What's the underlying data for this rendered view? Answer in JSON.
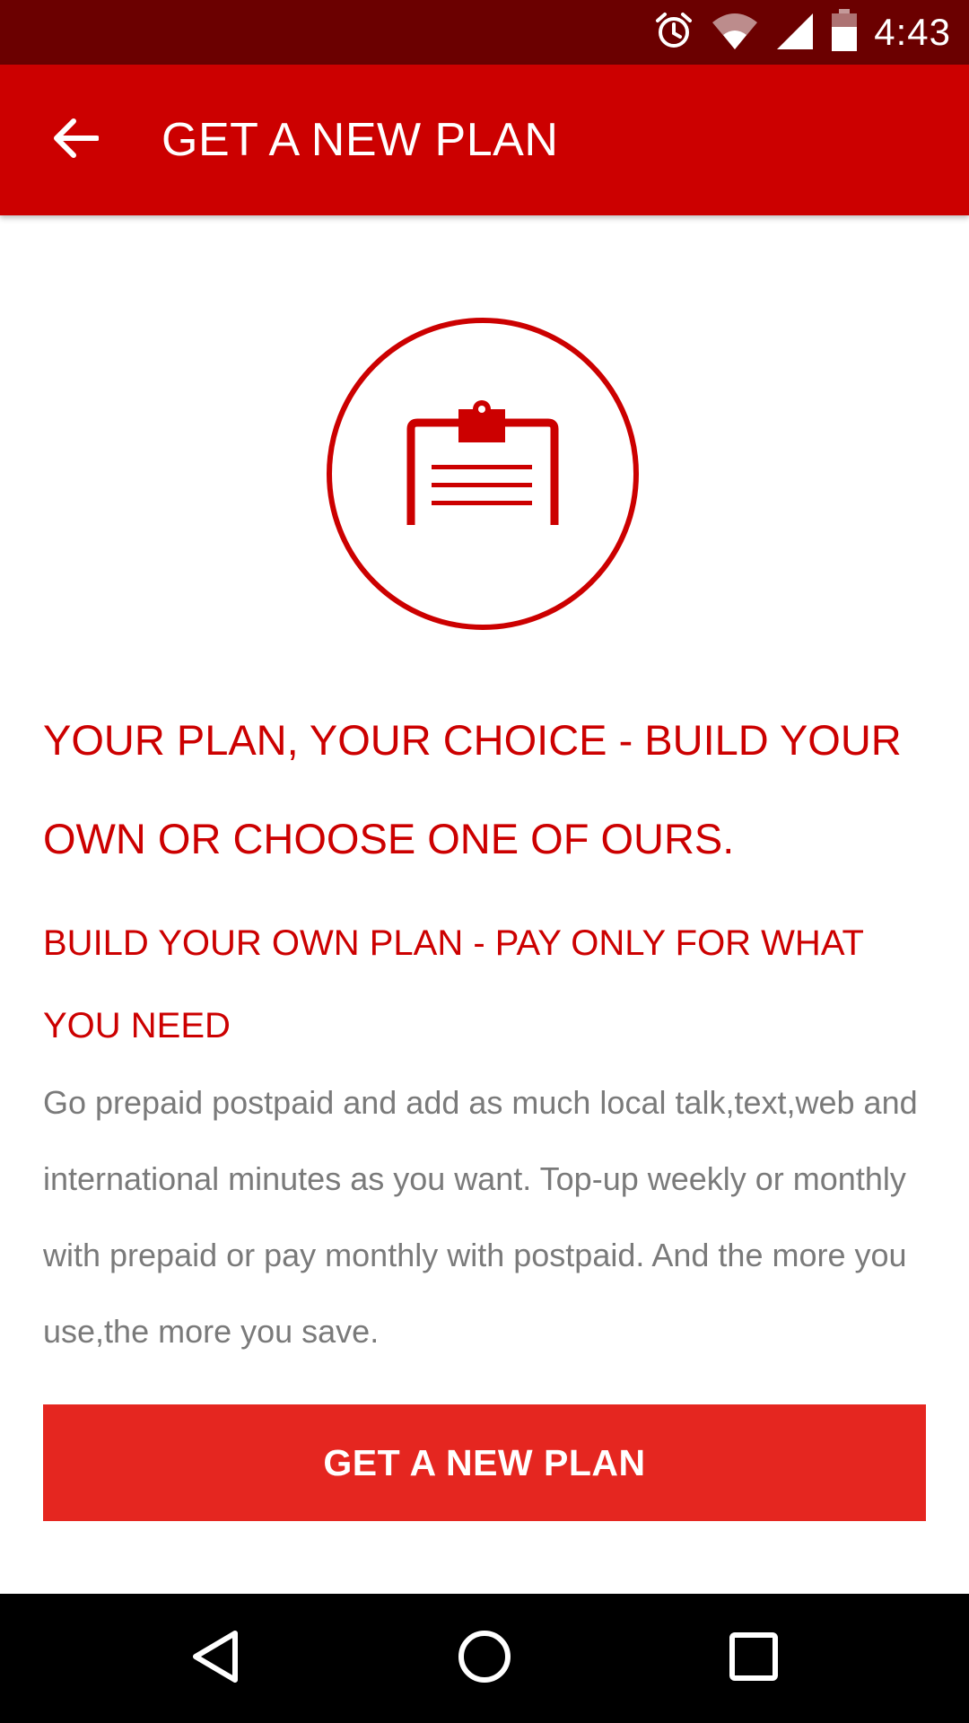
{
  "status_bar": {
    "time": "4:43",
    "icons": [
      "alarm-icon",
      "wifi-icon",
      "signal-icon",
      "battery-icon"
    ]
  },
  "app_bar": {
    "back_icon": "arrow-left-icon",
    "title": "GET A NEW PLAN"
  },
  "hero": {
    "icon": "clipboard-icon"
  },
  "content": {
    "headline": "YOUR PLAN, YOUR CHOICE - BUILD YOUR OWN OR CHOOSE ONE OF OURS.",
    "subhead": "BUILD YOUR OWN PLAN - PAY ONLY FOR WHAT YOU NEED",
    "body": "Go prepaid postpaid and add as much local talk,text,web and international minutes as you want. Top-up weekly or monthly with prepaid or pay monthly with postpaid. And the more you use,the more you save."
  },
  "cta": {
    "label": "GET A NEW PLAN"
  },
  "nav_bar": {
    "icons": [
      "nav-back-icon",
      "nav-home-icon",
      "nav-recents-icon"
    ]
  },
  "colors": {
    "status_bar": "#6b0000",
    "app_bar": "#cc0000",
    "accent": "#cc0000",
    "button": "#e52620",
    "body_text": "#7a7a7a"
  }
}
